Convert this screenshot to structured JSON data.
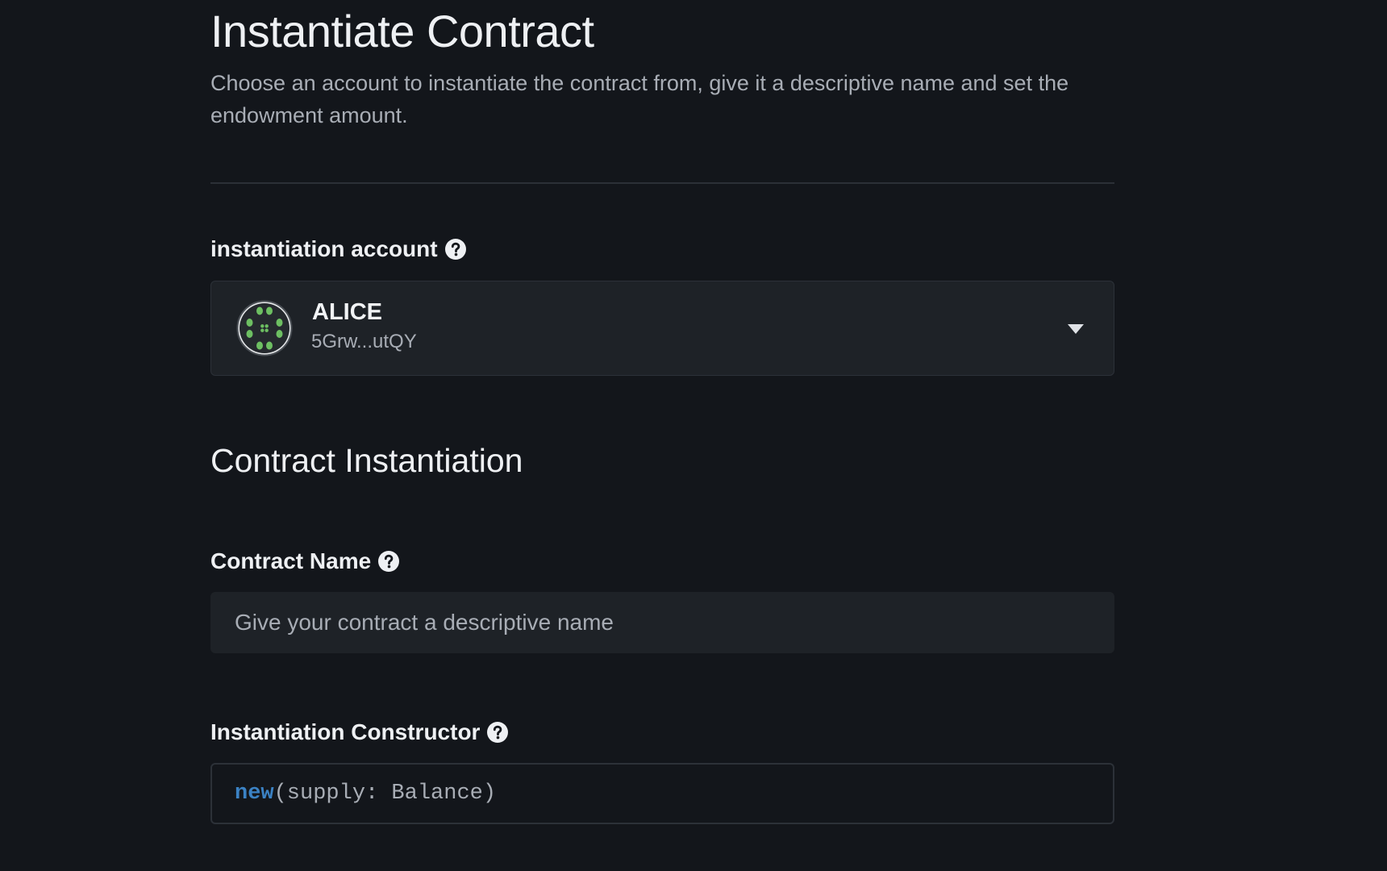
{
  "header": {
    "title": "Instantiate Contract",
    "subtitle": "Choose an account to instantiate the contract from, give it a descriptive name and set the endowment amount."
  },
  "account_field": {
    "label": "instantiation account",
    "help_icon": "question-circle-icon",
    "selected": {
      "name": "ALICE",
      "address": "5Grw...utQY",
      "avatar_icon": "identicon-avatar",
      "avatar_color": "#6dbf62"
    },
    "dropdown_icon": "chevron-down-icon"
  },
  "section": {
    "title": "Contract Instantiation"
  },
  "contract_name_field": {
    "label": "Contract Name",
    "help_icon": "question-circle-icon",
    "value": "",
    "placeholder": "Give your contract a descriptive name"
  },
  "constructor_field": {
    "label": "Instantiation Constructor",
    "help_icon": "question-circle-icon",
    "method_name": "new",
    "args": "(supply: Balance)",
    "method_color": "#3b82c4"
  },
  "theme": {
    "background": "#13161b",
    "surface": "#1e2227",
    "text": "#eef0f3",
    "muted_text": "#a8adb5"
  }
}
